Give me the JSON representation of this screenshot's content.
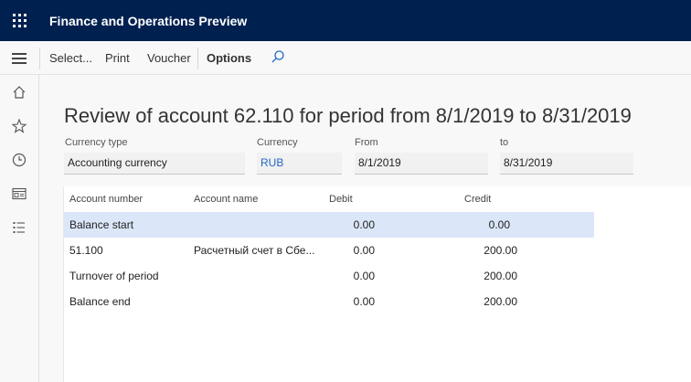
{
  "app": {
    "title": "Finance and Operations Preview"
  },
  "actions": {
    "select": "Select...",
    "print": "Print",
    "voucher": "Voucher",
    "options": "Options"
  },
  "page": {
    "title": "Review of account 62.110 for period from 8/1/2019 to 8/31/2019"
  },
  "fields": {
    "currency_type": {
      "label": "Currency type",
      "value": "Accounting currency"
    },
    "currency": {
      "label": "Currency",
      "value": "RUB"
    },
    "from": {
      "label": "From",
      "value": "8/1/2019"
    },
    "to": {
      "label": "to",
      "value": "8/31/2019"
    }
  },
  "grid": {
    "columns": [
      "Account number",
      "Account name",
      "Debit",
      "Credit"
    ],
    "rows": [
      {
        "account_number": "Balance start",
        "account_name": "",
        "debit": "0.00",
        "credit": "0.00",
        "selected": true
      },
      {
        "account_number": "51.100",
        "account_name": "Расчетный счет в Сбе...",
        "debit": "0.00",
        "credit": "200.00",
        "selected": false
      },
      {
        "account_number": "Turnover of period",
        "account_name": "",
        "debit": "0.00",
        "credit": "200.00",
        "selected": false
      },
      {
        "account_number": "Balance end",
        "account_name": "",
        "debit": "0.00",
        "credit": "200.00",
        "selected": false
      }
    ]
  },
  "icons": {
    "waffle": "app-launcher-icon",
    "hamburger": "hamburger-menu-icon",
    "search": "search-icon",
    "nav": [
      "home-icon",
      "favorites-star-icon",
      "recent-clock-icon",
      "workspaces-icon",
      "modules-list-icon"
    ]
  },
  "colors": {
    "topbar": "#002050",
    "selected_row": "#dbe6f8",
    "link": "#2266c4"
  }
}
